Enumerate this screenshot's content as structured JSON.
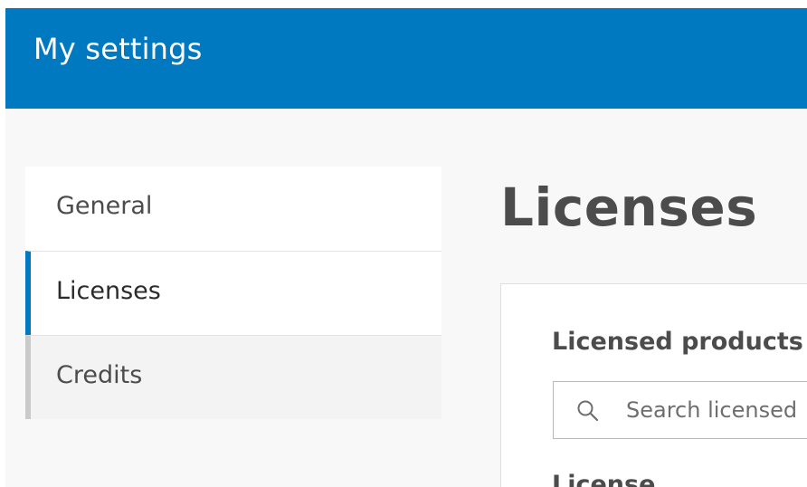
{
  "header": {
    "title": "My settings"
  },
  "sidebar": {
    "items": [
      {
        "label": "General",
        "state": "default"
      },
      {
        "label": "Licenses",
        "state": "active"
      },
      {
        "label": "Credits",
        "state": "inactive"
      }
    ]
  },
  "main": {
    "page_title": "Licenses",
    "panel": {
      "section_title": "Licensed products",
      "search": {
        "value": "",
        "placeholder": "Search licensed"
      },
      "subsection_title": "License"
    }
  },
  "colors": {
    "header_bg": "#0079c1",
    "active_indicator": "#0079c1",
    "inactive_indicator": "#cacaca",
    "page_bg": "#f8f8f8",
    "text_primary": "#4c4c4c"
  }
}
